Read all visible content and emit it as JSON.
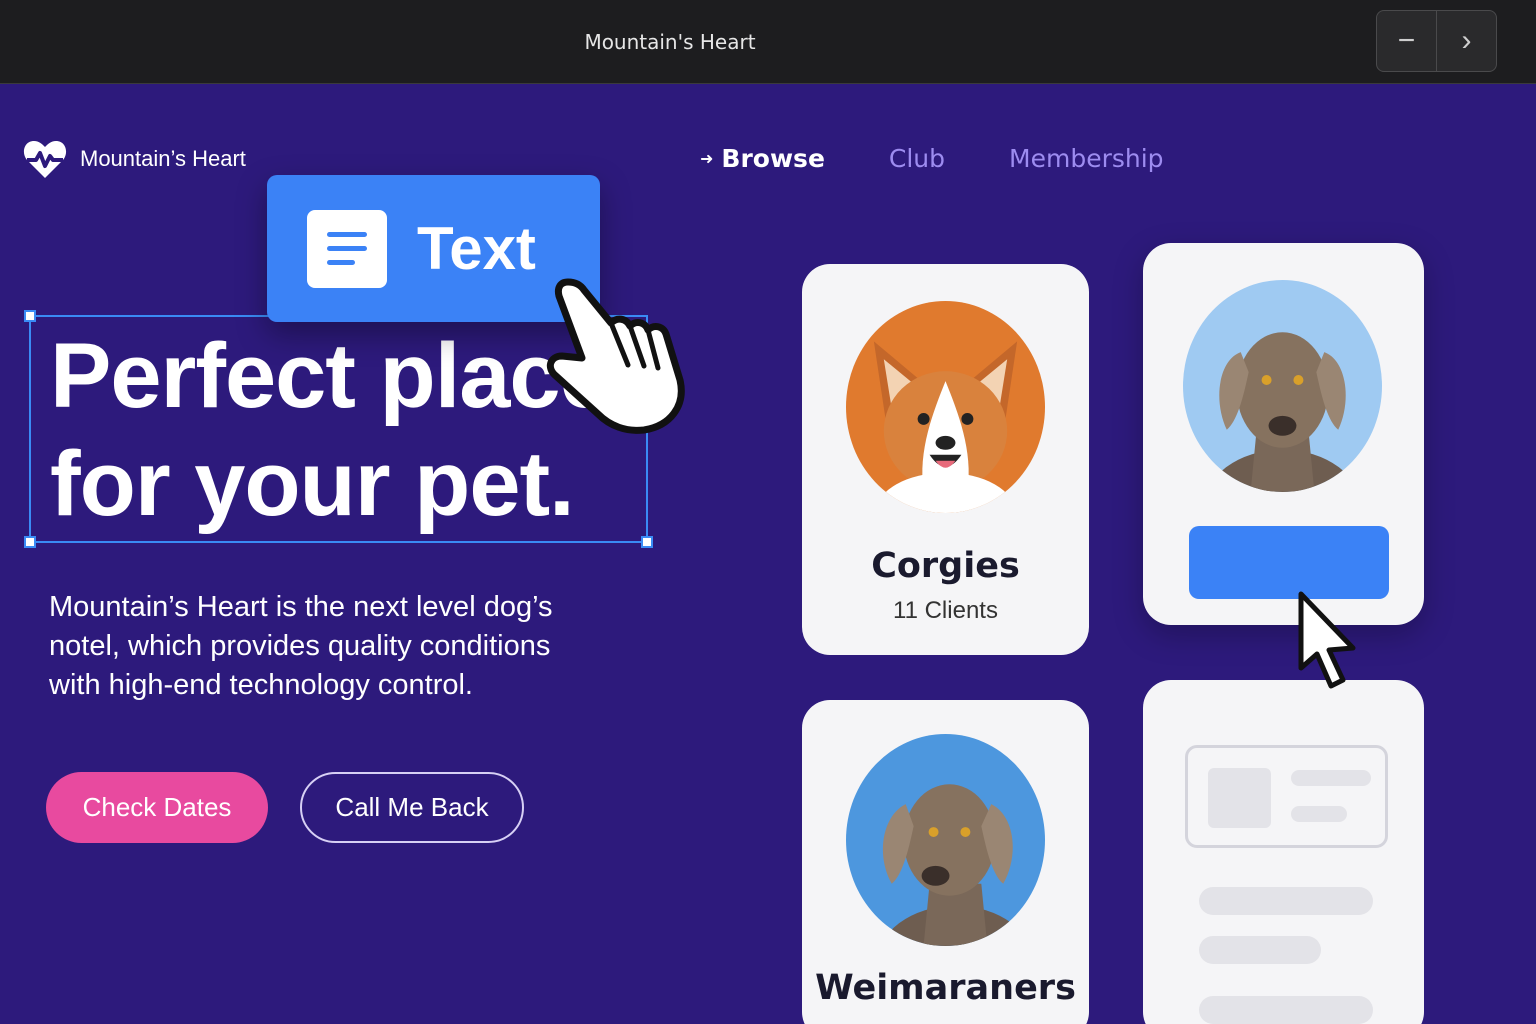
{
  "window": {
    "title": "Mountain's Heart",
    "controls": {
      "minimize_glyph": "−",
      "next_glyph": "›"
    }
  },
  "brand": {
    "name": "Mountain’s Heart",
    "logo_icon": "heart-logo-icon"
  },
  "nav": {
    "items": [
      {
        "label": "Browse",
        "active": true,
        "icon": "arrow-right-icon",
        "icon_glyph": "➜"
      },
      {
        "label": "Club",
        "active": false
      },
      {
        "label": "Membership",
        "active": false
      }
    ]
  },
  "hero": {
    "headline_line1": "Perfect place",
    "headline_line2": "for your pet.",
    "description": "Mountain’s Heart is the next level dog’s notel, which provides quality conditions with high-end technology control.",
    "primary_button": "Check Dates",
    "secondary_button": "Call Me Back"
  },
  "editor": {
    "text_chip_label": "Text",
    "text_chip_icon": "text-align-icon"
  },
  "cards": [
    {
      "title": "Corgies",
      "subtitle": "11 Clients",
      "avatar_bg": "#e07a2e"
    },
    {
      "title": "",
      "subtitle": "",
      "avatar_bg": "#9fcaf2"
    },
    {
      "title": "Weimaraners",
      "subtitle": "",
      "avatar_bg": "#4d97de"
    }
  ],
  "colors": {
    "background": "#2d1a7c",
    "accent_blue": "#3b82f6",
    "accent_pink": "#e84a9f",
    "nav_inactive": "#9d8cf0",
    "card": "#f5f5f7"
  }
}
